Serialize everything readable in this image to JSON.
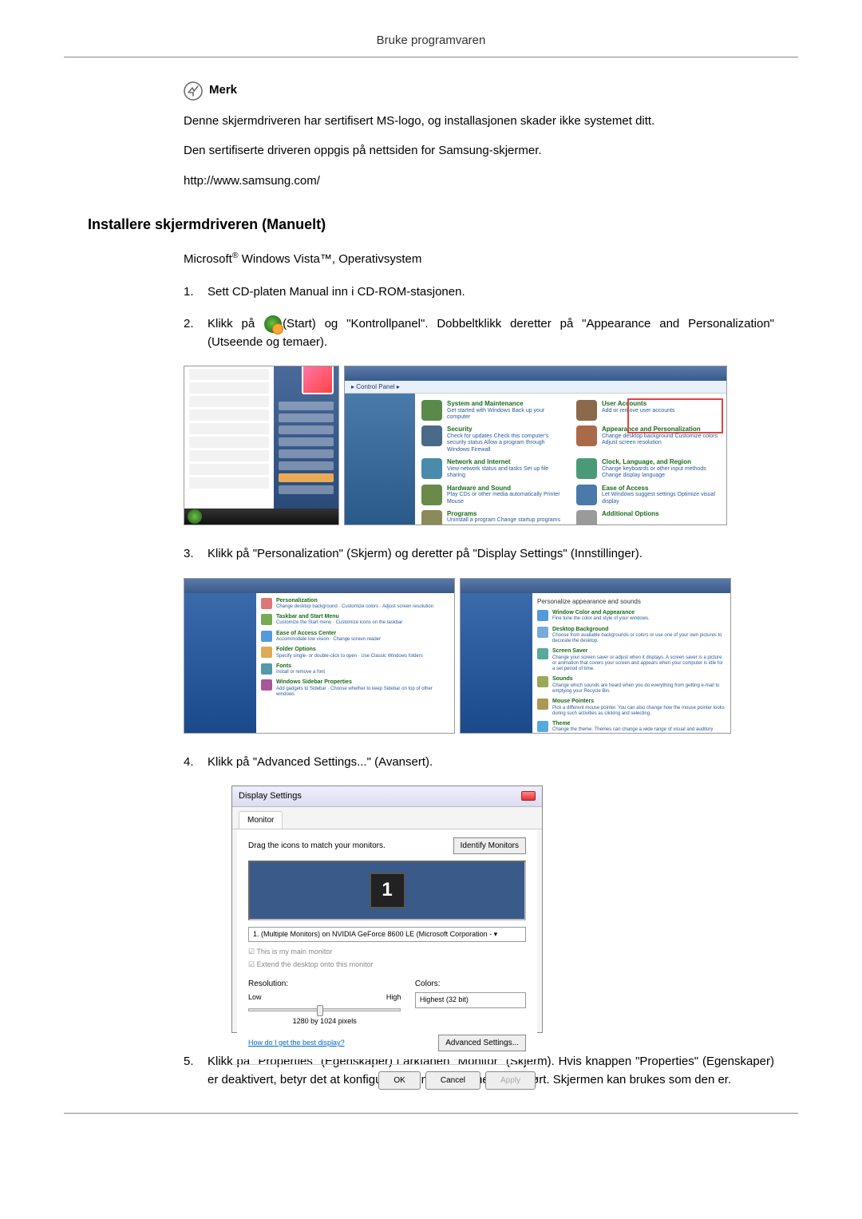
{
  "header": {
    "title": "Bruke programvaren"
  },
  "note": {
    "label": "Merk",
    "p1": "Denne skjermdriveren har sertifisert MS-logo, og installasjonen skader ikke systemet ditt.",
    "p2": "Den sertifiserte driveren oppgis på nettsiden for Samsung-skjermer.",
    "url": "http://www.samsung.com/"
  },
  "section": {
    "heading": "Installere skjermdriveren (Manuelt)",
    "subtitle_prefix": "Microsoft",
    "subtitle_mid": " Windows Vista™, Operativsystem"
  },
  "steps": {
    "s1": {
      "num": "1.",
      "text": "Sett CD-platen Manual inn i CD-ROM-stasjonen."
    },
    "s2": {
      "num": "2.",
      "pre": "Klikk på ",
      "post": "(Start) og \"Kontrollpanel\". Dobbeltklikk deretter på \"Appearance and Personalization\" (Utseende og temaer)."
    },
    "s3": {
      "num": "3.",
      "text": "Klikk på \"Personalization\" (Skjerm) og deretter på \"Display Settings\" (Innstillinger)."
    },
    "s4": {
      "num": "4.",
      "text": "Klikk på \"Advanced Settings...\" (Avansert)."
    },
    "s5": {
      "num": "5.",
      "text": "Klikk på \"Properties\" (Egenskaper) i arkfanen \"Monitor\" (Skjerm). Hvis knappen \"Properties\" (Egenskaper) er deaktivert, betyr det at konfigurasjonen av skjermen er fullført. Skjermen kan brukes som den er."
    }
  },
  "control_panel": {
    "breadcrumb": "▸ Control Panel ▸",
    "cats": [
      {
        "title": "System and Maintenance",
        "sub": "Get started with Windows\nBack up your computer"
      },
      {
        "title": "User Accounts",
        "sub": "Add or remove user accounts"
      },
      {
        "title": "Security",
        "sub": "Check for updates\nCheck this computer's security status\nAllow a program through Windows Firewall"
      },
      {
        "title": "Appearance and Personalization",
        "sub": "Change desktop background\nCustomize colors\nAdjust screen resolution"
      },
      {
        "title": "Network and Internet",
        "sub": "View network status and tasks\nSet up file sharing"
      },
      {
        "title": "Clock, Language, and Region",
        "sub": "Change keyboards or other input methods\nChange display language"
      },
      {
        "title": "Hardware and Sound",
        "sub": "Play CDs or other media automatically\nPrinter\nMouse"
      },
      {
        "title": "Ease of Access",
        "sub": "Let Windows suggest settings\nOptimize visual display"
      },
      {
        "title": "Programs",
        "sub": "Uninstall a program\nChange startup programs"
      },
      {
        "title": "Additional Options",
        "sub": ""
      }
    ]
  },
  "display_settings": {
    "window_title": "Display Settings",
    "tab": "Monitor",
    "desc": "Drag the icons to match your monitors.",
    "identify": "Identify Monitors",
    "monitor_number": "1",
    "dropdown": "1. (Multiple Monitors) on NVIDIA GeForce 8600 LE (Microsoft Corporation - ▾",
    "check1": "This is my main monitor",
    "check2": "Extend the desktop onto this monitor",
    "resolution_label": "Resolution:",
    "low": "Low",
    "high": "High",
    "resolution_value": "1280 by 1024 pixels",
    "colors_label": "Colors:",
    "colors_value": "Highest (32 bit)",
    "help_link": "How do I get the best display?",
    "advanced": "Advanced Settings...",
    "ok": "OK",
    "cancel": "Cancel",
    "apply": "Apply"
  }
}
